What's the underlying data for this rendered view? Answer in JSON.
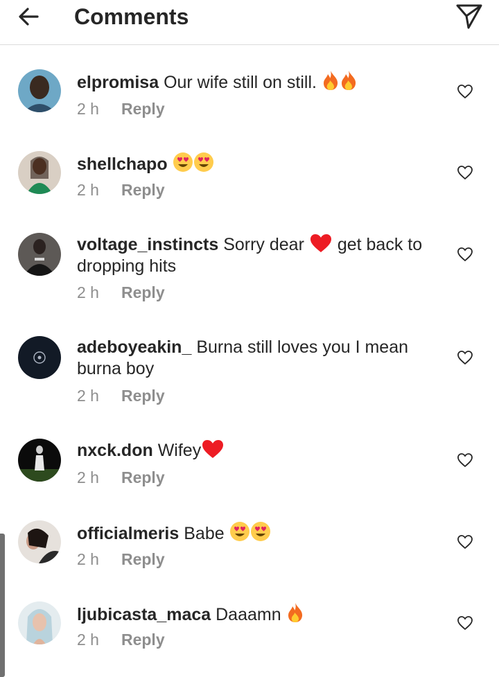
{
  "header": {
    "title": "Comments",
    "back_icon": "arrow-left-icon",
    "send_icon": "paper-plane-icon"
  },
  "colors": {
    "text": "#262626",
    "muted": "#8e8e8e",
    "divider": "#dbdbdb",
    "heart": "#ed1c24"
  },
  "comments": [
    {
      "username": "elpromisa",
      "text": "Our wife still on still.",
      "emojis": [
        "fire",
        "fire"
      ],
      "time": "2 h",
      "reply": "Reply"
    },
    {
      "username": "shellchapo",
      "text": "",
      "emojis": [
        "heart-eyes",
        "heart-eyes"
      ],
      "time": "2 h",
      "reply": "Reply"
    },
    {
      "username": "voltage_instincts",
      "text": "Sorry dear",
      "emojis": [
        "red-heart"
      ],
      "text_after": "get back to dropping hits",
      "time": "2 h",
      "reply": "Reply"
    },
    {
      "username": "adeboyeakin_",
      "text": "Burna still loves you I mean burna boy",
      "emojis": [],
      "time": "2 h",
      "reply": "Reply"
    },
    {
      "username": "nxck.don",
      "text": "Wifey",
      "emojis": [
        "red-heart"
      ],
      "time": "2 h",
      "reply": "Reply"
    },
    {
      "username": "officialmeris",
      "text": "Babe",
      "emojis": [
        "heart-eyes",
        "heart-eyes"
      ],
      "time": "2 h",
      "reply": "Reply"
    },
    {
      "username": "ljubicasta_maca",
      "text": "Daaamn",
      "emojis": [
        "fire"
      ],
      "time": "2 h",
      "reply": "Reply"
    }
  ]
}
